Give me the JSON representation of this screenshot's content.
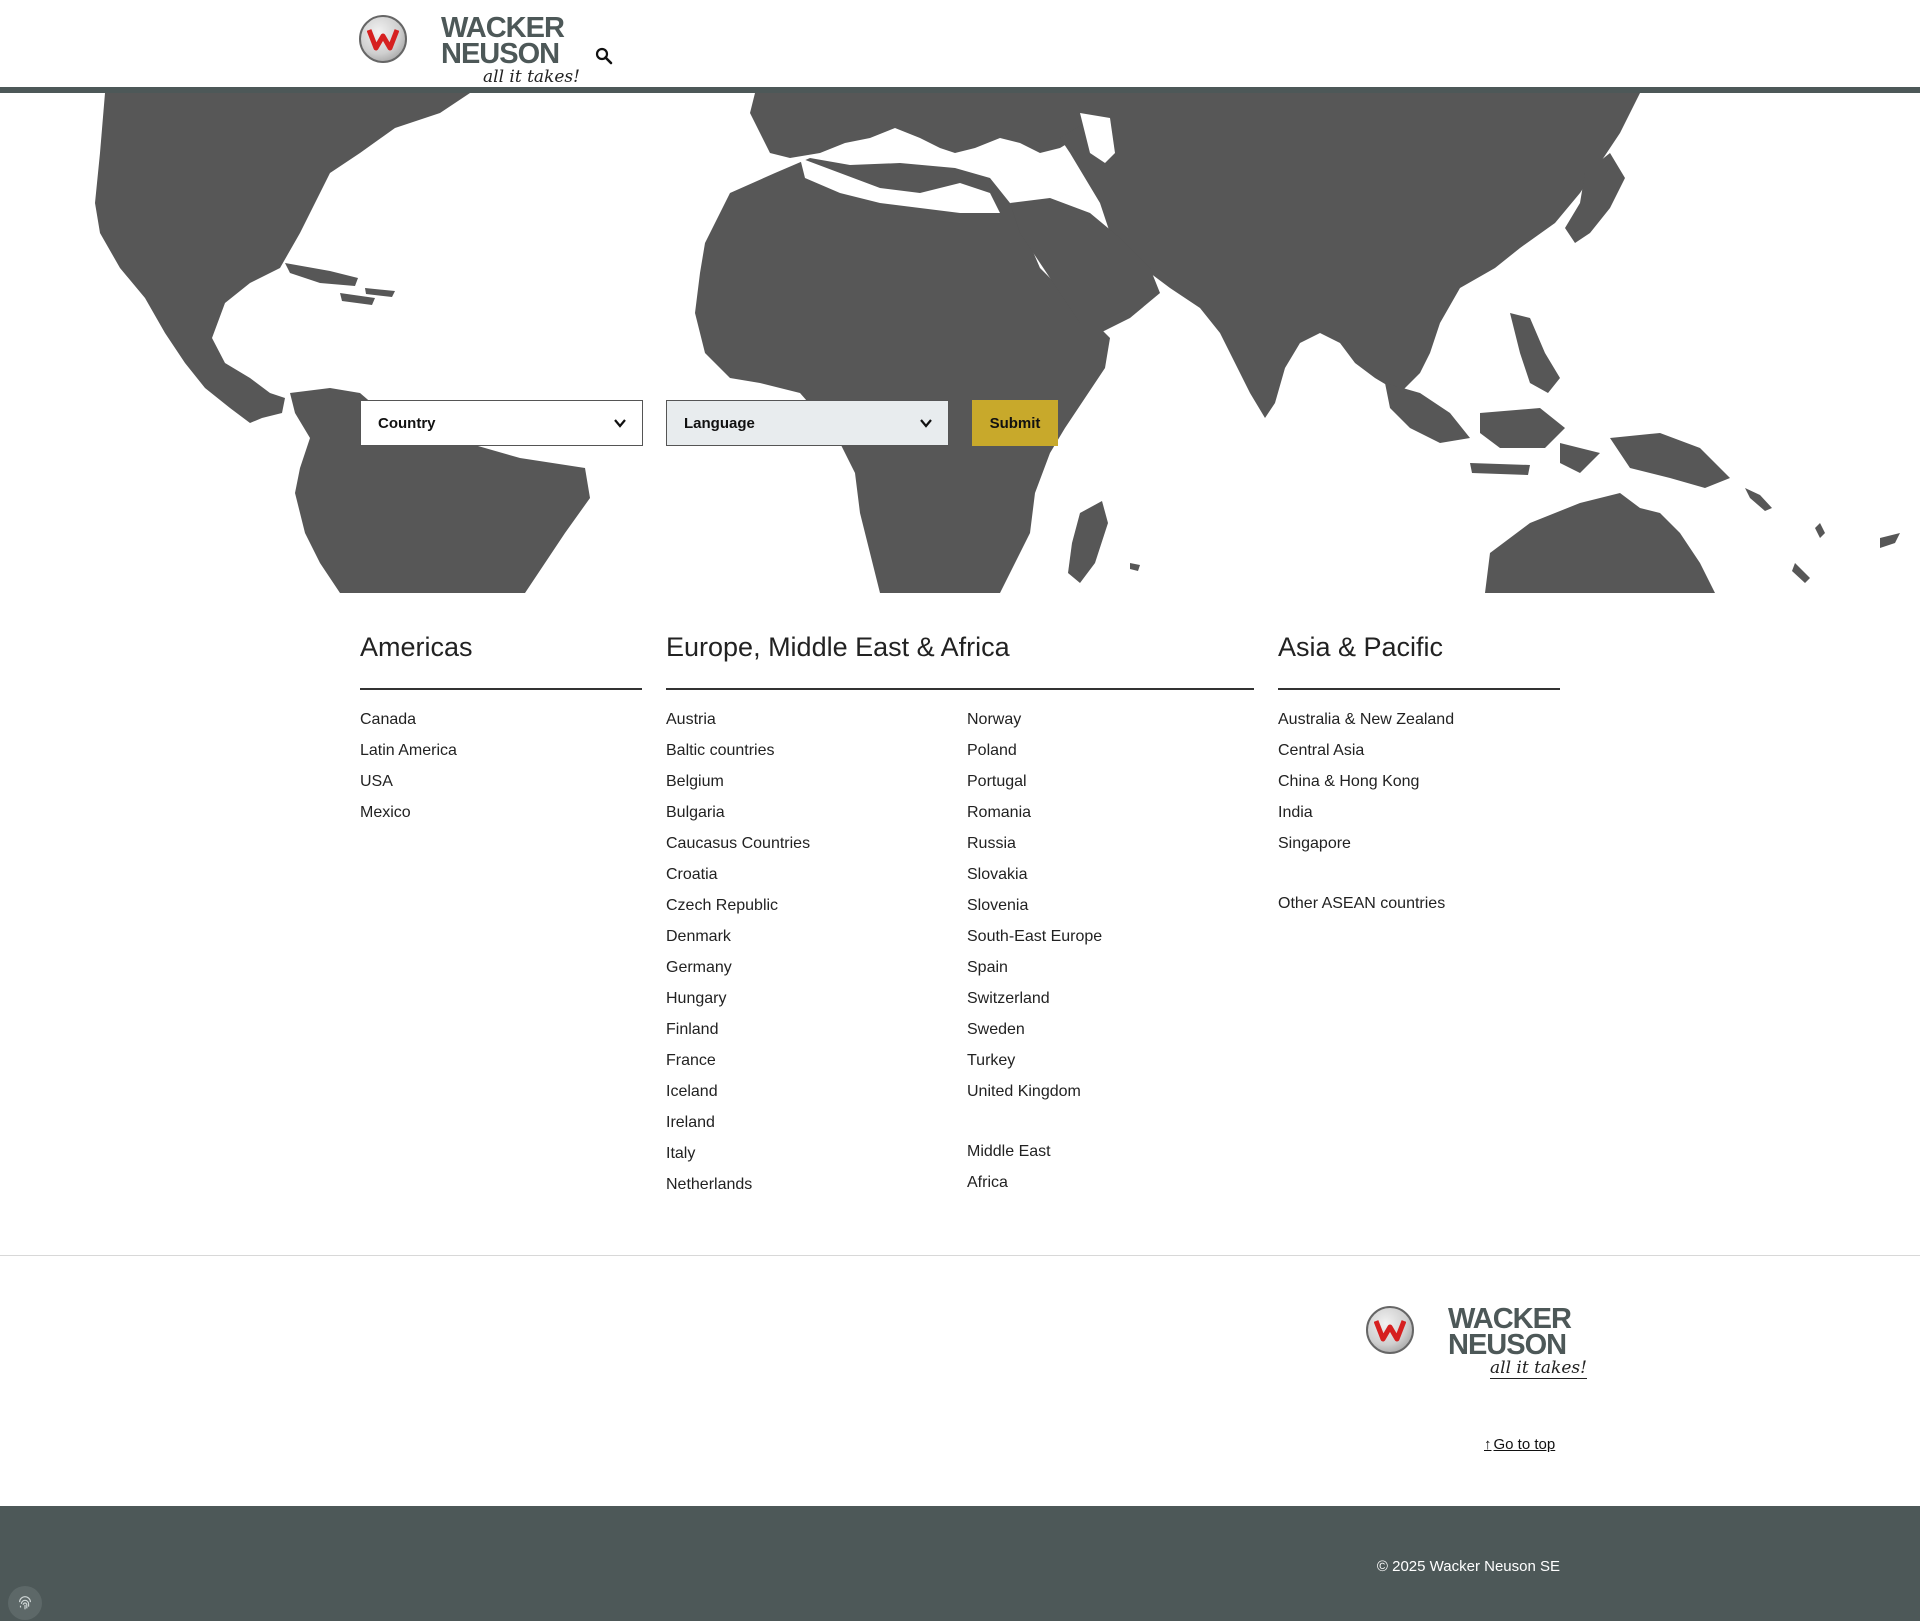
{
  "header": {
    "logo": {
      "line1": "WACKER",
      "line2": "NEUSON",
      "tagline": "all it takes!"
    }
  },
  "selector": {
    "country_label": "Country",
    "language_label": "Language",
    "submit_label": "Submit"
  },
  "regions": {
    "americas": {
      "title": "Americas",
      "items": [
        "Canada",
        "Latin America",
        "USA",
        "Mexico"
      ]
    },
    "emea": {
      "title": "Europe, Middle East & Africa",
      "col1": [
        "Austria",
        "Baltic countries",
        "Belgium",
        "Bulgaria",
        "Caucasus Countries",
        "Croatia",
        "Czech Republic",
        "Denmark",
        "Germany",
        "Hungary",
        "Finland",
        "France",
        "Iceland",
        "Ireland",
        "Italy",
        "Netherlands"
      ],
      "col2": [
        "Norway",
        "Poland",
        "Portugal",
        "Romania",
        "Russia",
        "Slovakia",
        "Slovenia",
        "South-East Europe",
        "Spain",
        "Switzerland",
        "Sweden",
        "Turkey",
        "United Kingdom"
      ],
      "col2_extra": [
        "Middle East",
        "Africa"
      ]
    },
    "apac": {
      "title": "Asia & Pacific",
      "items": [
        "Australia & New Zealand",
        "Central Asia",
        "China & Hong Kong",
        "India",
        "Singapore"
      ],
      "extra": [
        "Other ASEAN countries"
      ]
    }
  },
  "footer": {
    "logo": {
      "line1": "WACKER",
      "line2": "NEUSON",
      "tagline": "all it takes!"
    },
    "go_top_label": "Go to top",
    "copyright": "© 2025 Wacker Neuson SE"
  },
  "colors": {
    "brand_dark": "#4d5858",
    "map_land": "#575757",
    "submit_accent": "#c8a92b"
  }
}
